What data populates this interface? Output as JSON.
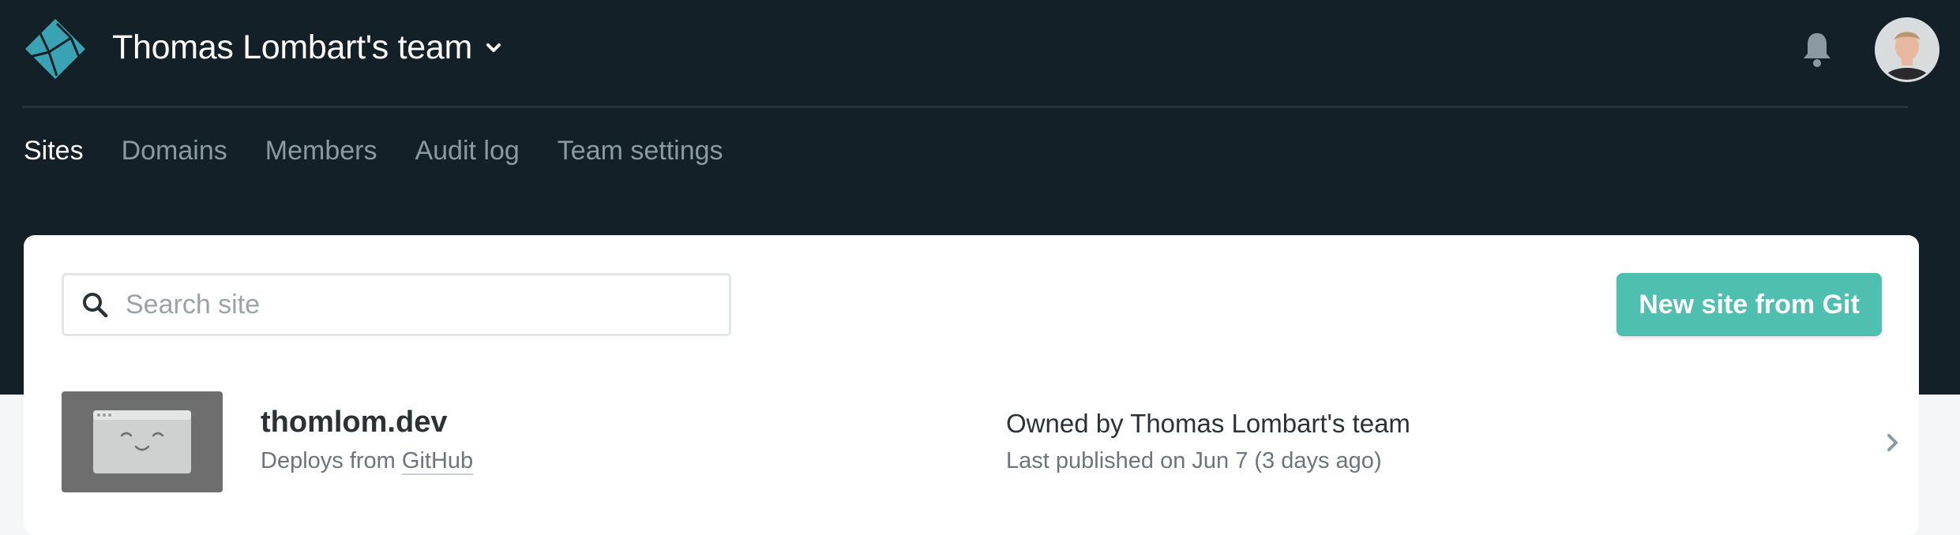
{
  "header": {
    "team_name": "Thomas Lombart's team",
    "logo_icon": "netlify-logo",
    "chevron_icon": "chevron-down-icon",
    "bell_icon": "bell-icon",
    "avatar_icon": "user-avatar"
  },
  "tabs": [
    {
      "label": "Sites",
      "active": true
    },
    {
      "label": "Domains",
      "active": false
    },
    {
      "label": "Members",
      "active": false
    },
    {
      "label": "Audit log",
      "active": false
    },
    {
      "label": "Team settings",
      "active": false
    }
  ],
  "search": {
    "placeholder": "Search site",
    "value": "",
    "icon": "search-icon"
  },
  "new_site_button": {
    "label": "New site from Git"
  },
  "sites": [
    {
      "name": "thomlom.dev",
      "deploys_prefix": "Deploys from ",
      "deploys_source": "GitHub",
      "owned_prefix": "Owned by ",
      "owner": "Thomas Lombart's team",
      "published": "Last published on Jun 7 (3 days ago)"
    }
  ],
  "colors": {
    "header_bg": "#142027",
    "accent": "#4fbfb0",
    "page_bg": "#f4f6f8"
  }
}
